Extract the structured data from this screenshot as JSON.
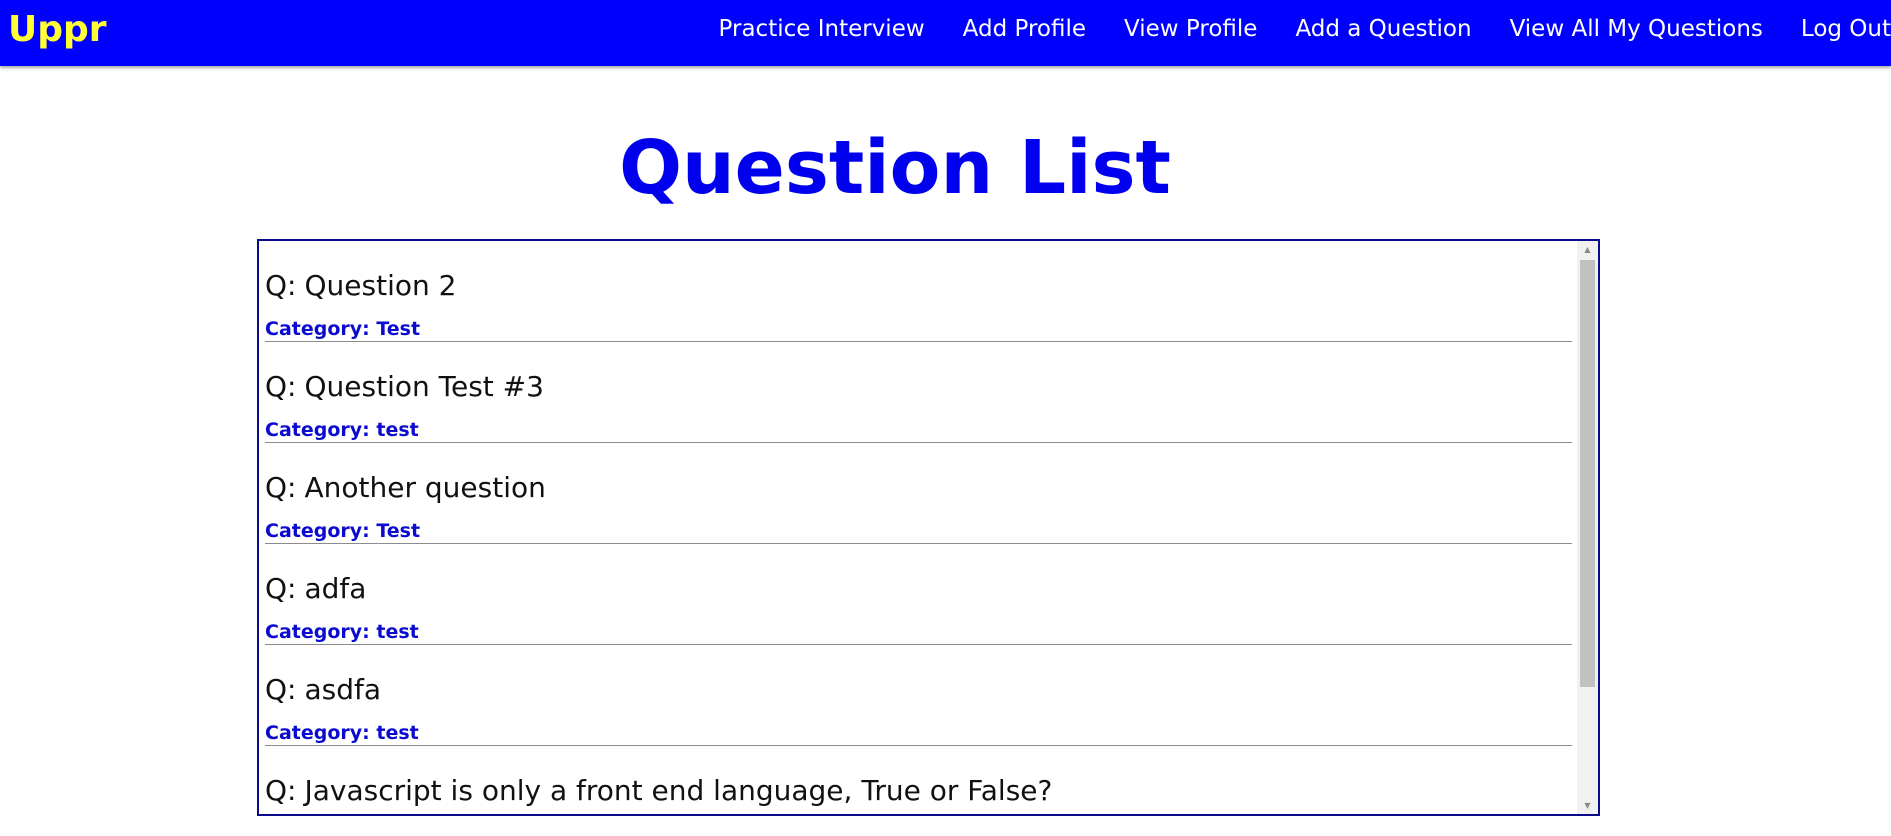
{
  "navbar": {
    "brand": "Uppr",
    "links": [
      "Practice Interview",
      "Add Profile",
      "View Profile",
      "Add a Question",
      "View All My Questions",
      "Log Out"
    ]
  },
  "page": {
    "title": "Question List"
  },
  "questions": [
    {
      "prefix": "Q:",
      "text": "Question 2",
      "category": "Category: Test"
    },
    {
      "prefix": "Q:",
      "text": "Question Test #3",
      "category": "Category: test"
    },
    {
      "prefix": "Q:",
      "text": "Another question",
      "category": "Category: Test"
    },
    {
      "prefix": "Q:",
      "text": "adfa",
      "category": "Category: test"
    },
    {
      "prefix": "Q:",
      "text": "asdfa",
      "category": "Category: test"
    },
    {
      "prefix": "Q:",
      "text": "Javascript is only a front end language, True or False?",
      "category": ""
    }
  ],
  "scrollbar": {
    "up_icon": "arrow-up-icon",
    "down_icon": "arrow-down-icon",
    "scroll_position": 0.0
  },
  "colors": {
    "navbar_bg": "#0000ff",
    "brand": "#ffff33",
    "title": "#0000ee",
    "category": "#0a0ad0"
  }
}
